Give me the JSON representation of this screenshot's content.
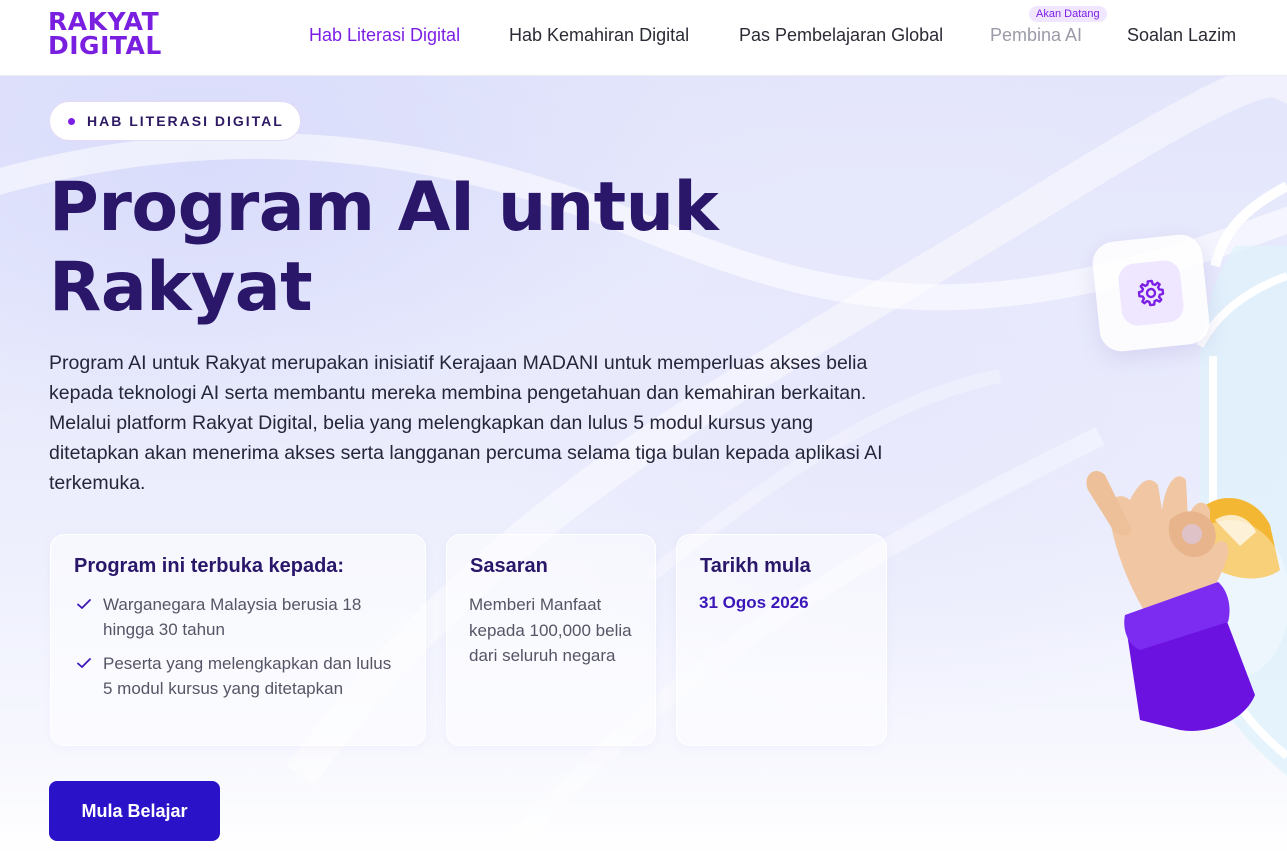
{
  "logo": {
    "line1": "RAKYAT",
    "line2": "DIGITAL"
  },
  "nav": {
    "items": [
      {
        "label": "Hab Literasi Digital",
        "state": "active"
      },
      {
        "label": "Hab Kemahiran Digital",
        "state": "normal"
      },
      {
        "label": "Pas Pembelajaran Global",
        "state": "normal"
      },
      {
        "label": "Pembina AI",
        "state": "disabled"
      },
      {
        "label": "Soalan Lazim",
        "state": "normal"
      }
    ],
    "badge": "Akan Datang"
  },
  "hero": {
    "pill": "HAB LITERASI DIGITAL",
    "title": "Program AI untuk Rakyat",
    "description": "Program AI untuk Rakyat merupakan inisiatif Kerajaan MADANI untuk memperluas akses belia kepada teknologi AI serta membantu mereka membina pengetahuan dan kemahiran berkaitan. Melalui platform Rakyat Digital, belia yang melengkapkan dan lulus 5 modul kursus yang ditetapkan akan menerima akses serta langganan percuma selama tiga bulan kepada aplikasi AI terkemuka."
  },
  "cards": {
    "eligibility": {
      "title": "Program ini terbuka kepada:",
      "items": [
        "Warganegara Malaysia berusia 18 hingga 30 tahun",
        "Peserta yang melengkapkan dan lulus 5 modul kursus yang ditetapkan"
      ]
    },
    "target": {
      "title": "Sasaran",
      "text": "Memberi Manfaat kepada 100,000 belia dari seluruh negara"
    },
    "start": {
      "title": "Tarikh mula",
      "date": "31 Ogos 2026"
    }
  },
  "cta": {
    "label": "Mula Belajar"
  },
  "icons": {
    "check": "check-icon",
    "gear": "gear-icon",
    "hand": "ok-hand-icon"
  },
  "colors": {
    "brand": "#7c1fe6",
    "heading": "#2a176a",
    "cta": "#2a12c9"
  }
}
